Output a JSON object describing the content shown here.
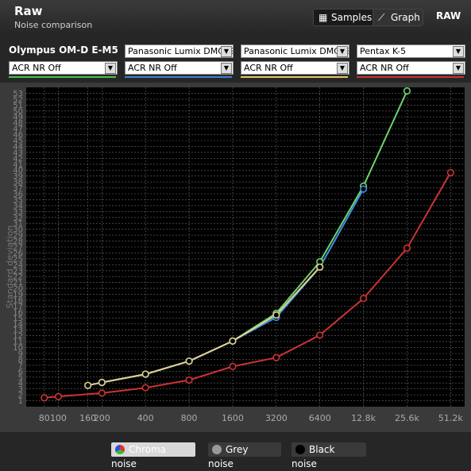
{
  "header": {
    "title": "Raw",
    "subtitle": "Noise comparison",
    "samples_label": "Samples",
    "graph_label": "Graph",
    "raw_label": "RAW"
  },
  "cameras": [
    {
      "name": "Olympus OM-D E-M5",
      "setting": "ACR NR Off",
      "color": "#4ec24e"
    },
    {
      "name": "Panasonic Lumix DMC-G",
      "setting": "ACR NR Off",
      "color": "#3f7fd6"
    },
    {
      "name": "Panasonic Lumix DMC-G",
      "setting": "ACR NR Off",
      "color": "#e6c867"
    },
    {
      "name": "Pentax K-5",
      "setting": "ACR NR Off",
      "color": "#cc3333"
    }
  ],
  "legend": {
    "chroma": "Chroma noise",
    "grey": "Grey noise",
    "black": "Black noise"
  },
  "chart_data": {
    "type": "line",
    "ylabel": "Standard deviation",
    "xlabel": "",
    "x_scale": "log2",
    "y_ticks": [
      1,
      2,
      3,
      4,
      5,
      6,
      7,
      8,
      9,
      10,
      11,
      12,
      13,
      14,
      15,
      16,
      17,
      18,
      19,
      20,
      21,
      22,
      23,
      24,
      25,
      26,
      27,
      28,
      29,
      30,
      31,
      32,
      33,
      34,
      35,
      36,
      37,
      38,
      39,
      40,
      41,
      42,
      43,
      44,
      45,
      46,
      47,
      48,
      49,
      50,
      51,
      52,
      53
    ],
    "ylim": [
      0,
      54
    ],
    "x_ticks": [
      "80",
      "100",
      "160",
      "200",
      "400",
      "800",
      "1600",
      "3200",
      "6400",
      "12.8k",
      "25.6k",
      "51.2k"
    ],
    "x_tick_values": [
      80,
      100,
      160,
      200,
      400,
      800,
      1600,
      3200,
      6400,
      12800,
      25600,
      51200
    ],
    "series": [
      {
        "name": "",
        "color": "#6fd26f",
        "x": [
          200,
          400,
          800,
          1600,
          3200,
          6400,
          12800,
          25600
        ],
        "y": [
          4.1,
          5.5,
          7.7,
          11.1,
          15.8,
          24.5,
          37.3,
          53.4
        ]
      },
      {
        "name": "",
        "color": "#3f8fe0",
        "x": [
          200,
          400,
          800,
          1600,
          3200,
          6400,
          12800
        ],
        "y": [
          4.1,
          5.5,
          7.7,
          11.1,
          15.1,
          23.6,
          36.8
        ]
      },
      {
        "name": "",
        "color": "#e0d090",
        "x": [
          160,
          200,
          400,
          800,
          1600,
          3200,
          6400
        ],
        "y": [
          3.6,
          4.1,
          5.5,
          7.7,
          11.1,
          15.5,
          23.6
        ]
      },
      {
        "name": "",
        "color": "#cc3333",
        "x": [
          80,
          100,
          200,
          400,
          800,
          1600,
          3200,
          6400,
          12800,
          25600,
          51200
        ],
        "y": [
          1.5,
          1.7,
          2.3,
          3.2,
          4.5,
          6.8,
          8.3,
          12.1,
          18.3,
          26.8,
          39.6
        ]
      }
    ]
  }
}
